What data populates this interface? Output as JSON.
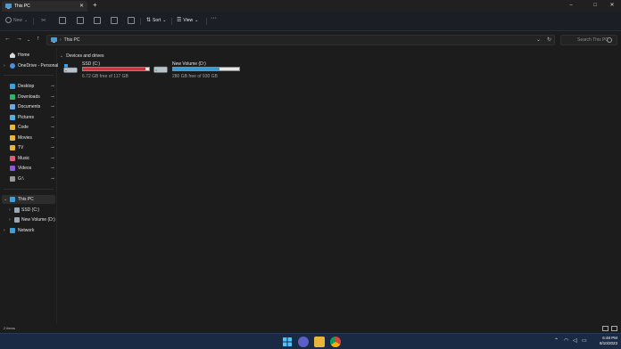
{
  "window": {
    "tab_title": "This PC",
    "new_tab": "+",
    "minimize": "–",
    "maximize": "□",
    "close": "✕"
  },
  "toolbar": {
    "new_label": "New",
    "sort_label": "Sort",
    "view_label": "View",
    "more_label": "···"
  },
  "address": {
    "path": "This PC",
    "search_placeholder": "Search This PC"
  },
  "sidebar": {
    "items": [
      {
        "label": "Home"
      },
      {
        "label": "OneDrive - Personal"
      },
      {
        "label": "Desktop"
      },
      {
        "label": "Downloads"
      },
      {
        "label": "Documents"
      },
      {
        "label": "Pictures"
      },
      {
        "label": "Code"
      },
      {
        "label": "Movies"
      },
      {
        "label": "TV"
      },
      {
        "label": "Music"
      },
      {
        "label": "Videos"
      },
      {
        "label": "G:\\"
      },
      {
        "label": "This PC"
      },
      {
        "label": "SSD (C:)"
      },
      {
        "label": "New Volume (D:)"
      },
      {
        "label": "Network"
      }
    ]
  },
  "main": {
    "group_header": "Devices and drives",
    "drives": [
      {
        "name": "SSD (C:)",
        "free_text": "6.72 GB free of 117 GB",
        "used_fraction": 0.94,
        "bar_color": "#c8363f"
      },
      {
        "name": "New Volume (D:)",
        "free_text": "280 GB free of 930 GB",
        "used_fraction": 0.7,
        "bar_color": "#3b9cd6"
      }
    ]
  },
  "status": {
    "items_text": "2 items"
  },
  "taskbar": {
    "time": "6:48 PM",
    "date": "8/10/2023"
  },
  "colors": {
    "accent": "#4cc2ff",
    "folder": "#e8b53a"
  }
}
